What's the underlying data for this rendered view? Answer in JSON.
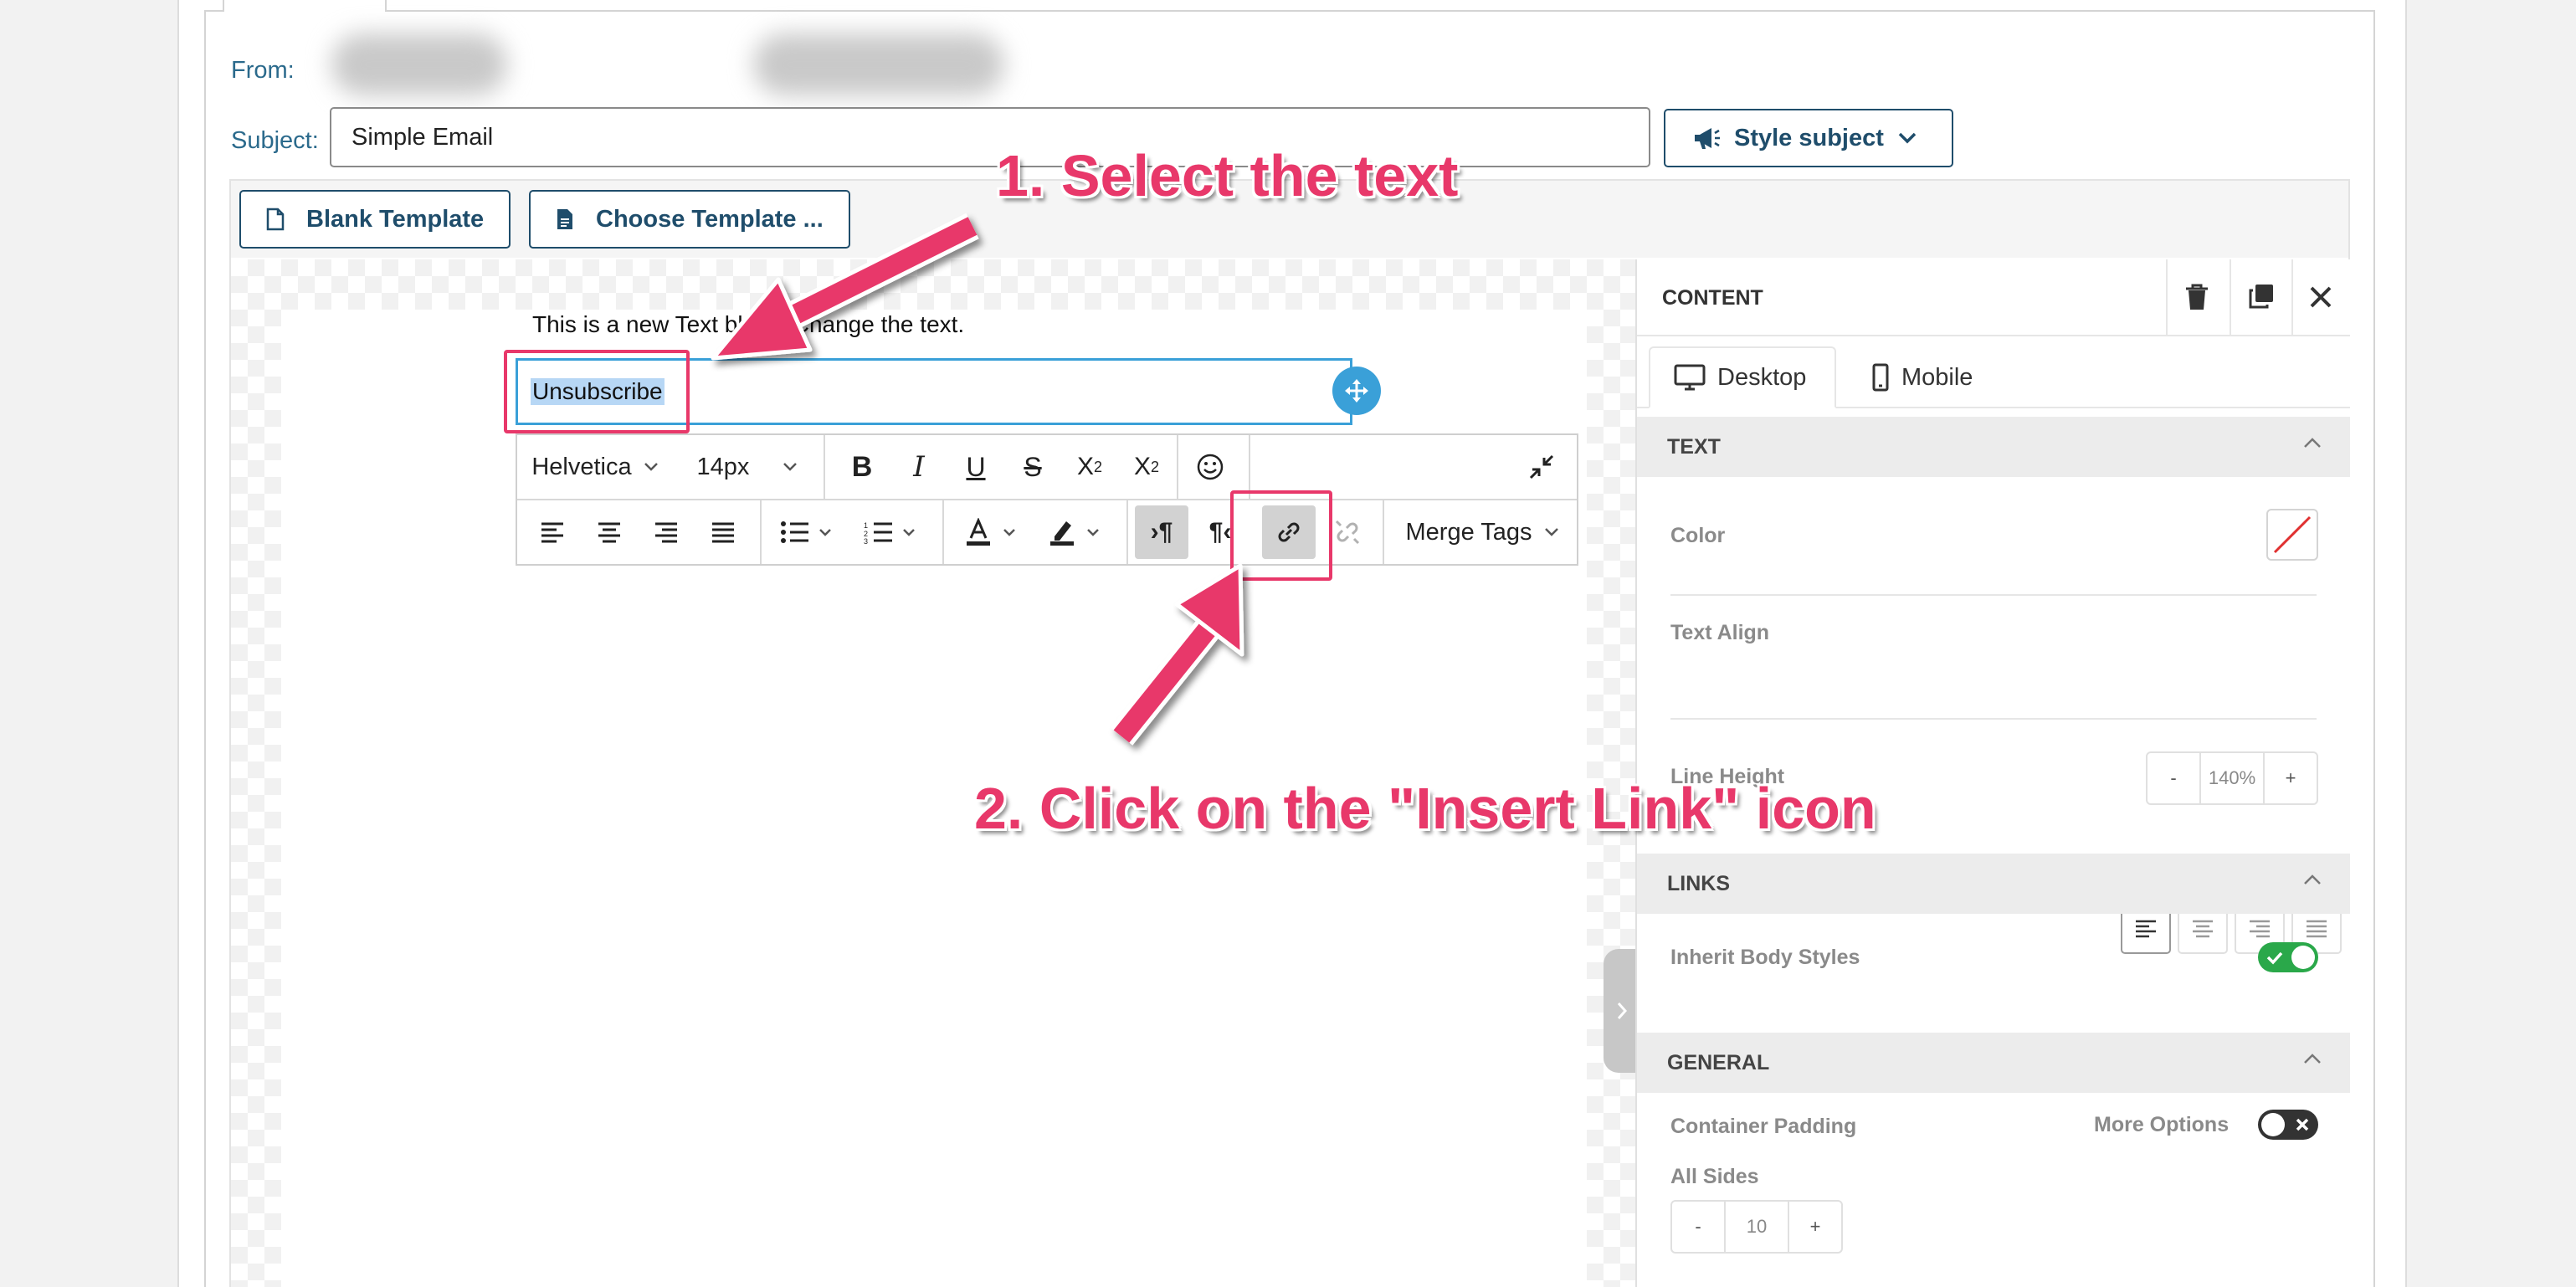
{
  "header": {
    "from_label": "From:",
    "subject_label": "Subject:",
    "subject_value": "Simple Email",
    "style_subject_label": "Style subject"
  },
  "templates": {
    "blank_label": "Blank Template",
    "choose_label": "Choose Template ..."
  },
  "editor": {
    "text_line": "This is a new Text block. Change the text.",
    "selected_text": "Unsubscribe"
  },
  "toolbar": {
    "font_family": "Helvetica",
    "font_size": "14px",
    "merge_tags_label": "Merge Tags",
    "icons": [
      "bold-icon",
      "italic-icon",
      "underline-icon",
      "strikethrough-icon",
      "superscript-icon",
      "subscript-icon",
      "emoji-icon",
      "collapse-icon",
      "align-left-icon",
      "align-center-icon",
      "align-right-icon",
      "align-justify-icon",
      "bullet-list-icon",
      "numbered-list-icon",
      "text-color-icon",
      "highlight-icon",
      "ltr-icon",
      "rtl-icon",
      "insert-link-icon",
      "remove-link-icon"
    ]
  },
  "panel": {
    "title": "CONTENT",
    "tab_desktop": "Desktop",
    "tab_mobile": "Mobile",
    "text_section": "TEXT",
    "color_label": "Color",
    "text_align_label": "Text Align",
    "line_height_label": "Line Height",
    "line_height_value": "140%",
    "links_section": "LINKS",
    "inherit_label": "Inherit Body Styles",
    "inherit_on": true,
    "general_section": "GENERAL",
    "container_padding_label": "Container Padding",
    "more_options_label": "More Options",
    "more_options_on": false,
    "all_sides_label": "All Sides",
    "padding_value": "10",
    "minus": "-",
    "plus": "+"
  },
  "annotations": {
    "step1": "1. Select the text",
    "step2": "2. Click on the \"Insert Link\" icon"
  },
  "colors": {
    "annotation": "#e8386a",
    "brand": "#1f4d6b",
    "selection_border": "#3aa0d8",
    "toggle_on": "#2aa84a"
  }
}
